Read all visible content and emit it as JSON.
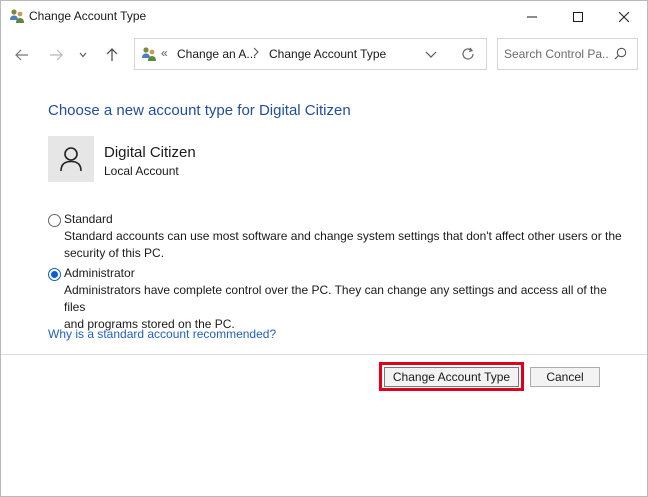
{
  "window": {
    "title": "Change Account Type",
    "icon": "users-control-panel-icon"
  },
  "nav": {
    "breadcrumb_sep": "«",
    "breadcrumb": [
      "Change an A...",
      "Change Account Type"
    ],
    "search_placeholder": "Search Control Pa..."
  },
  "main": {
    "heading": "Choose a new account type for Digital Citizen",
    "user": {
      "name": "Digital Citizen",
      "account_type": "Local Account"
    },
    "options": [
      {
        "label": "Standard",
        "selected": false,
        "description_lines": [
          "Standard accounts can use most software and change system settings that don't affect other users or the",
          "security of this PC."
        ]
      },
      {
        "label": "Administrator",
        "selected": true,
        "description_lines": [
          "Administrators have complete control over the PC. They can change any settings and access all of the files",
          "and programs stored on the PC."
        ]
      }
    ],
    "help_link": "Why is a standard account recommended?"
  },
  "buttons": {
    "primary": "Change Account Type",
    "cancel": "Cancel"
  },
  "colors": {
    "accent": "#0a5fcf",
    "heading": "#1f4e9c",
    "highlight": "#e0001b"
  }
}
